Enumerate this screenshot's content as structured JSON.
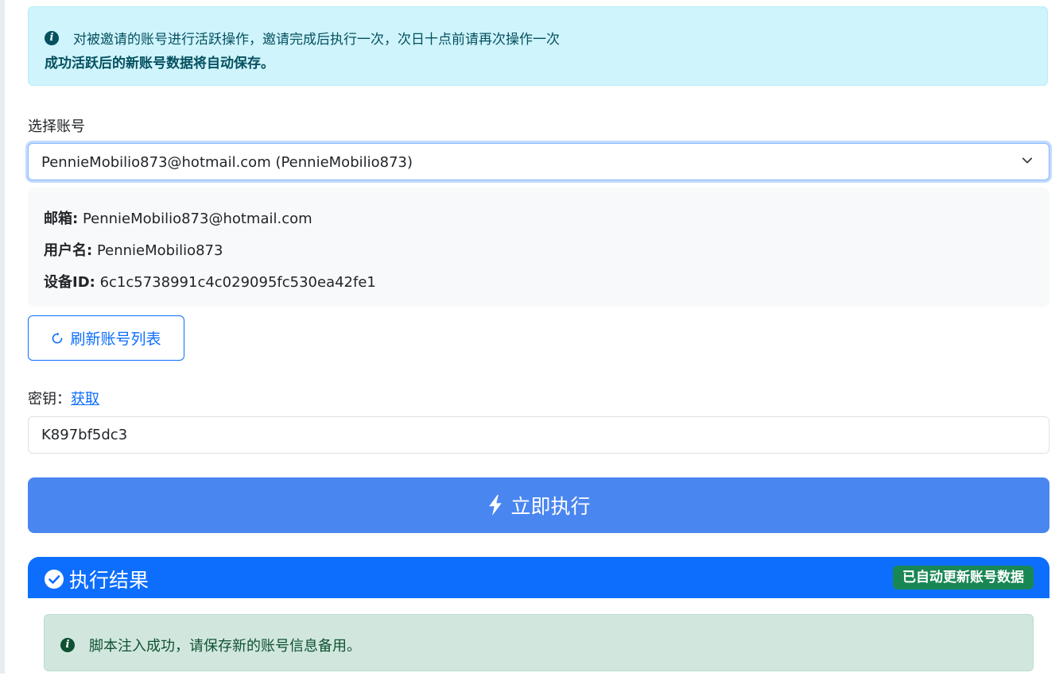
{
  "info_alert": {
    "line1": "对被邀请的账号进行活跃操作，邀请完成后执行一次，次日十点前请再次操作一次",
    "line2": "成功活跃后的新账号数据将自动保存。",
    "icon": "info-circle-icon"
  },
  "account_select": {
    "label": "选择账号",
    "selected": "PennieMobilio873@hotmail.com (PennieMobilio873)"
  },
  "account_info": {
    "email_label": "邮箱:",
    "email": "PennieMobilio873@hotmail.com",
    "username_label": "用户名:",
    "username": "PennieMobilio873",
    "device_label": "设备ID:",
    "device_id": "6c1c5738991c4c029095fc530ea42fe1"
  },
  "refresh_button": {
    "label": "刷新账号列表",
    "icon": "refresh-icon"
  },
  "key": {
    "label": "密钥：",
    "link": "获取",
    "value": "K897bf5dc3"
  },
  "execute_button": {
    "label": "立即执行",
    "icon": "bolt-icon"
  },
  "result": {
    "title": "执行结果",
    "badge": "已自动更新账号数据",
    "message": "脚本注入成功，请保存新的账号信息备用。",
    "icon": "check-circle-icon"
  },
  "colors": {
    "primary": "#0d6efd",
    "execute": "#4a86f0",
    "info_bg": "#cff4fc",
    "success": "#198754",
    "success_bg": "#d1e7dd"
  }
}
